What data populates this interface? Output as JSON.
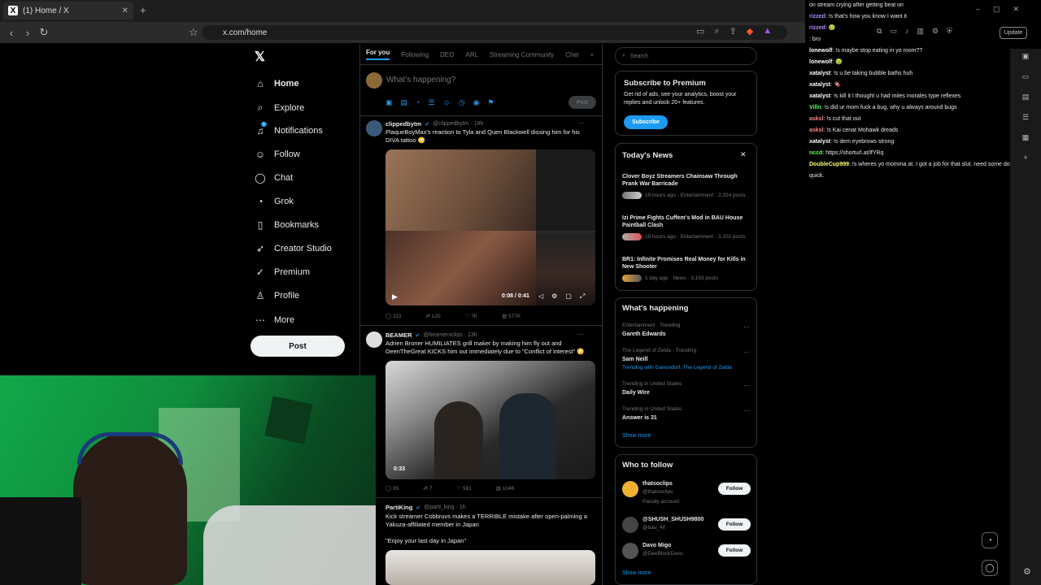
{
  "browser": {
    "tab_title": "(1) Home / X",
    "url": "x.com/home",
    "update_label": "Update"
  },
  "nav": {
    "items": [
      {
        "label": "Home",
        "icon": "home-icon",
        "glyph": "⌂"
      },
      {
        "label": "Explore",
        "icon": "search-icon",
        "glyph": "⌕"
      },
      {
        "label": "Notifications",
        "icon": "bell-icon",
        "glyph": "♫"
      },
      {
        "label": "Follow",
        "icon": "add-user-icon",
        "glyph": "☺"
      },
      {
        "label": "Chat",
        "icon": "chat-icon",
        "glyph": "◯"
      },
      {
        "label": "Grok",
        "icon": "grok-icon",
        "glyph": "◔"
      },
      {
        "label": "Bookmarks",
        "icon": "bookmark-icon",
        "glyph": "▯"
      },
      {
        "label": "Creator Studio",
        "icon": "rocket-icon",
        "glyph": "➶"
      },
      {
        "label": "Premium",
        "icon": "premium-icon",
        "glyph": "✓"
      },
      {
        "label": "Profile",
        "icon": "profile-icon",
        "glyph": "♙"
      },
      {
        "label": "More",
        "icon": "more-icon",
        "glyph": "⋯"
      }
    ],
    "notif_badge": "1",
    "post_label": "Post"
  },
  "timeline": {
    "tabs": [
      "For you",
      "Following",
      "DEO",
      "ARL",
      "Streaming Community",
      "Chei"
    ],
    "compose_placeholder": "What's happening?",
    "compose_post": "Post",
    "tweets": [
      {
        "name": "clippedbytm",
        "handle": "@clippedbytm · 19h",
        "text": "PlaqueBoyMax's reaction to Tyla and Quen Blackwell dissing him for his DIVA tattoo 😳",
        "video_time": "0:08 / 0:41",
        "replies": "113",
        "retweets": "120",
        "likes": "7K",
        "views": "577K"
      },
      {
        "name": "BEAMER",
        "handle": "@beamerxclips · 13h",
        "text": "Adrien Broner HUMILIATES grill maker by making him fly out and DeenTheGreat KICKS him out immediately due to \"Conflict of interest\" 😳",
        "video_time": "0:33",
        "replies": "65",
        "retweets": "7",
        "likes": "561",
        "views": "104K"
      },
      {
        "name": "PartiKing",
        "handle": "@parti_king · 1h",
        "text": "Kick streamer Cobbruvs makes a TERRIBLE mistake after open-palming a Yakuza-affiliated member in Japan",
        "quote": "\"Enjoy your last day in Japan\""
      }
    ]
  },
  "right": {
    "search_placeholder": "Search",
    "premium": {
      "title": "Subscribe to Premium",
      "body": "Get rid of ads, see your analytics, boost your replies and unlock 20+ features.",
      "button": "Subscribe"
    },
    "news": {
      "title": "Today's News",
      "items": [
        {
          "title": "Clover Boyz Streamers Chainsaw Through Prank War Barricade",
          "meta": "19 hours ago · Entertainment · 2,324 posts"
        },
        {
          "title": "Izi Prime Fights Cuffem's Mod in BAU House Paintball Clash",
          "meta": "19 hours ago · Entertainment · 3,102 posts"
        },
        {
          "title": "BR1: Infinite Promises Real Money for Kills in New Shooter",
          "meta": "1 day ago · News · 3,193 posts"
        }
      ]
    },
    "happening": {
      "title": "What's happening",
      "items": [
        {
          "context": "Entertainment · Trending",
          "topic": "Gareth Edwards"
        },
        {
          "context": "The Legend of Zelda · Trending",
          "topic": "Sam Neill",
          "extra": "Trending with Ganondorf, The Legend of Zelda"
        },
        {
          "context": "Trending in United States",
          "topic": "Daily Wire"
        },
        {
          "context": "Trending in United States",
          "topic": "Answer is 31"
        }
      ],
      "show_more": "Show more"
    },
    "who": {
      "title": "Who to follow",
      "items": [
        {
          "name": "thatsoclips",
          "handle": "@thatsoclips",
          "note": "Parody account",
          "button": "Follow"
        },
        {
          "name": "@SHUSH_SHUSH9800",
          "handle": "@bau_4lf",
          "button": "Follow"
        },
        {
          "name": "Davo Migo",
          "handle": "@DeeBlockDavo",
          "button": "Follow"
        }
      ],
      "show_more": "Show more"
    }
  },
  "chat": {
    "lines": [
      {
        "user": "",
        "color": "#ffffff",
        "msg": "on stream crying after getting beat on"
      },
      {
        "user": "rizzed",
        "color": "#b38cff",
        "msg": ": !s that's how you know I want it"
      },
      {
        "user": "rizzed",
        "color": "#b38cff",
        "msg": ": 🤢"
      },
      {
        "user": "",
        "color": "#ff4444",
        "msg": ": bro"
      },
      {
        "user": "lonewolf",
        "color": "#ffffff",
        "msg": ": !s maybe stop eating in yo room??"
      },
      {
        "user": "lonewolf",
        "color": "#ffffff",
        "msg": ": 🤢"
      },
      {
        "user": "xatalyst",
        "color": "#ffffff",
        "msg": ": !s u be taking bubble baths huh"
      },
      {
        "user": "xatalyst",
        "color": "#ffffff",
        "msg": ": 🍫"
      },
      {
        "user": "xatalyst",
        "color": "#ffffff",
        "msg": ": !s kill it I thought u had miles morales type reflexes"
      },
      {
        "user": "Villn",
        "color": "#5cff5c",
        "msg": ": !s did ur mom fuck a bug, why u always around bugs"
      },
      {
        "user": "asksl",
        "color": "#ff8888",
        "msg": ": !s cut that out"
      },
      {
        "user": "asksl",
        "color": "#ff8888",
        "msg": ": !s Kai cenat Mohawk dreads"
      },
      {
        "user": "xatalyst",
        "color": "#ffffff",
        "msg": ": !s dem eyebrows strong"
      },
      {
        "user": "nccd",
        "color": "#5cff5c",
        "msg": ": https://shorturl.at/lfYRq"
      },
      {
        "user": "DoubleCup999",
        "color": "#ffff66",
        "msg": ": !s wheres yo momma at. I got a job for that slut. need some done quick."
      }
    ]
  },
  "colors": {
    "accent": "#1d9bf0",
    "bg": "#000000",
    "webcam": "#12a84a"
  }
}
